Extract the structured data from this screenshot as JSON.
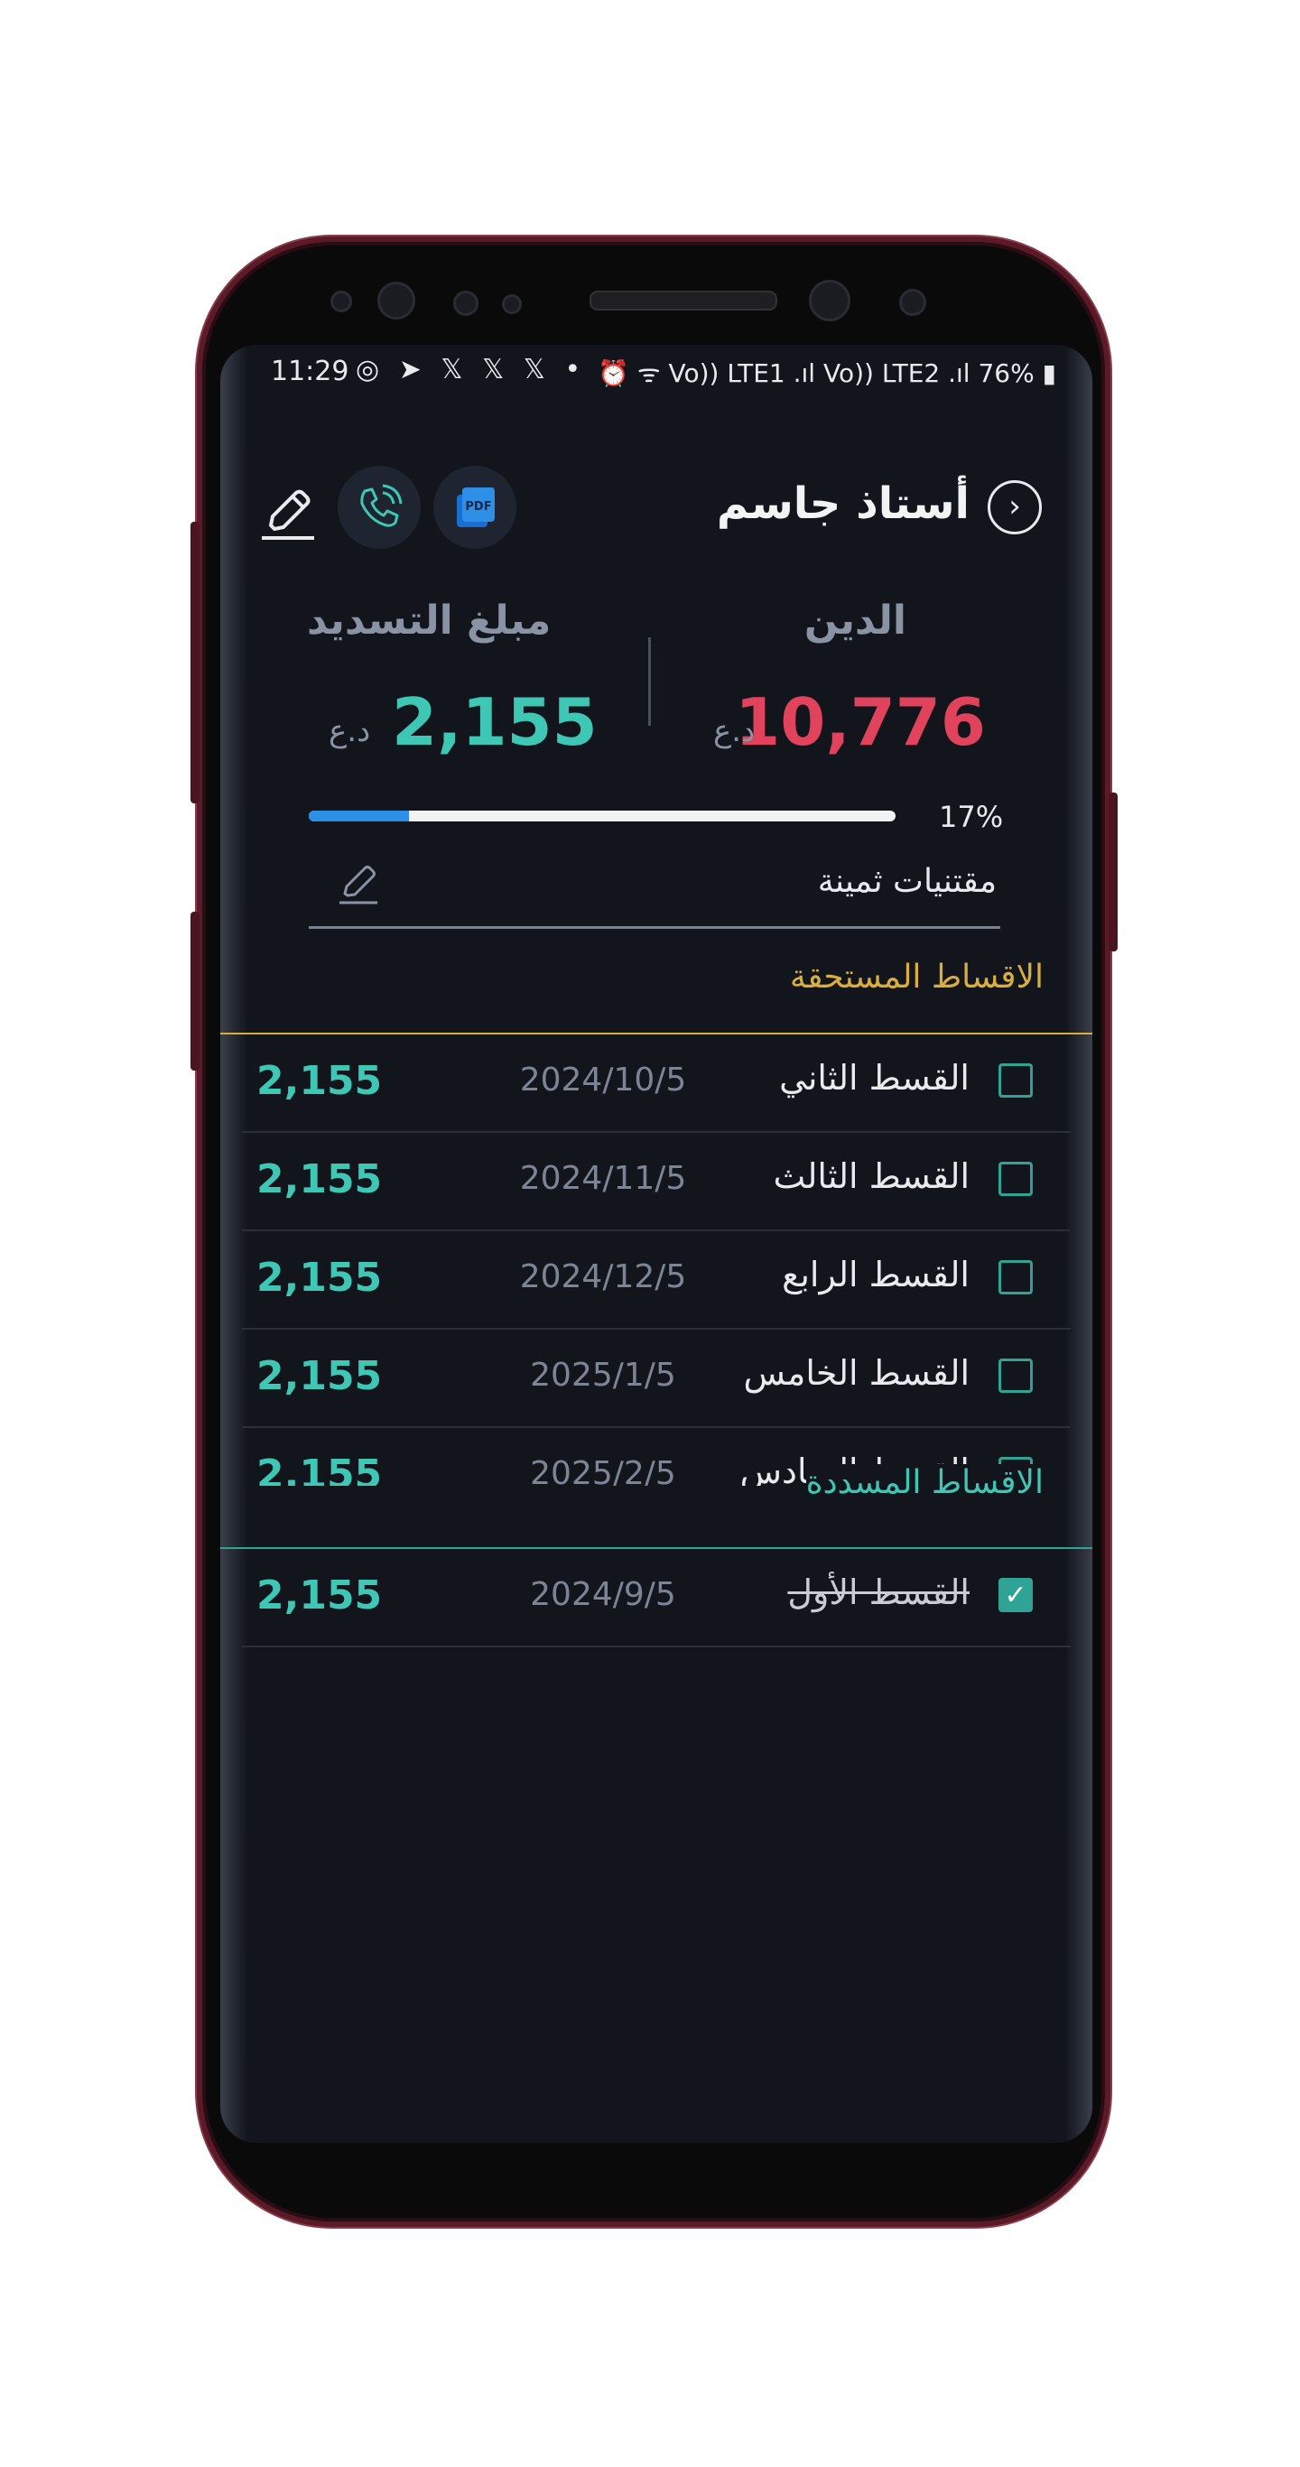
{
  "status_bar": {
    "time": "11:29",
    "app_icons": "◎ ➤ 𝕏 𝕏 𝕏 •",
    "right": "⏰ ᯤ Vo)) LTE1 .ıl Vo)) LTE2 .ıl 76% ▮"
  },
  "header": {
    "title": "أستاذ جاسم",
    "back_icon": "chevron-right-icon",
    "pdf_icon": "pdf-icon",
    "phone_icon": "phone-icon",
    "edit_icon": "edit-icon"
  },
  "summary": {
    "debt_label": "الدين",
    "debt_value": "10,776",
    "debt_currency": "د.ع",
    "payment_label": "مبلغ التسديد",
    "payment_value": "2,155",
    "payment_currency": "د.ع",
    "progress_percent_text": "17%",
    "progress_fraction": 0.17,
    "note": "مقتنيات ثمينة"
  },
  "due_section": {
    "title": "الاقساط المستحقة",
    "rows": [
      {
        "name": "القسط الثاني",
        "date": "2024/10/5",
        "amount": "2,155"
      },
      {
        "name": "القسط الثالث",
        "date": "2024/11/5",
        "amount": "2,155"
      },
      {
        "name": "القسط الرابع",
        "date": "2024/12/5",
        "amount": "2,155"
      },
      {
        "name": "القسط الخامس",
        "date": "2025/1/5",
        "amount": "2,155"
      },
      {
        "name": "القسط السادس",
        "date": "2025/2/5",
        "amount": "2,155"
      }
    ]
  },
  "paid_section": {
    "title": "الاقساط المسددة",
    "rows": [
      {
        "name": "القسط الأول",
        "date": "2024/9/5",
        "amount": "2,155",
        "checkmark": "✓"
      }
    ]
  },
  "colors": {
    "background": "#12151c",
    "debt": "#e0435b",
    "payment": "#3ec7b4",
    "due_accent": "#d9ae3c",
    "paid_accent": "#2fa394",
    "progress": "#2d8fe6"
  }
}
